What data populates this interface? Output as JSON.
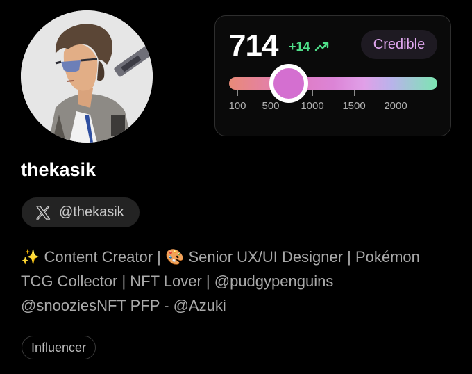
{
  "profile": {
    "display_name": "thekasik",
    "handle": "@thekasik",
    "bio_lines": [
      "✨ Content Creator | 🎨 Senior UX/UI Designer | Pokémon",
      "TCG Collector | NFT Lover | @pudgypenguins",
      "@snooziesNFT PFP - @Azuki"
    ],
    "tag": "Influencer",
    "avatar_icon": "avatar-image"
  },
  "score": {
    "value": "714",
    "delta": "+14",
    "delta_icon": "trending-up-icon",
    "tier": "Credible",
    "slider_value": 714,
    "scale": {
      "min": 0,
      "max": 2500
    },
    "ticks": [
      {
        "value": 100,
        "label": "100"
      },
      {
        "value": 500,
        "label": "500"
      },
      {
        "value": 1000,
        "label": "1000"
      },
      {
        "value": 1500,
        "label": "1500"
      },
      {
        "value": 2000,
        "label": "2000"
      }
    ]
  },
  "colors": {
    "background": "#000000",
    "delta_green": "#4fe08a",
    "tier_text": "#e0a7ef",
    "thumb": "#d46fd0"
  }
}
